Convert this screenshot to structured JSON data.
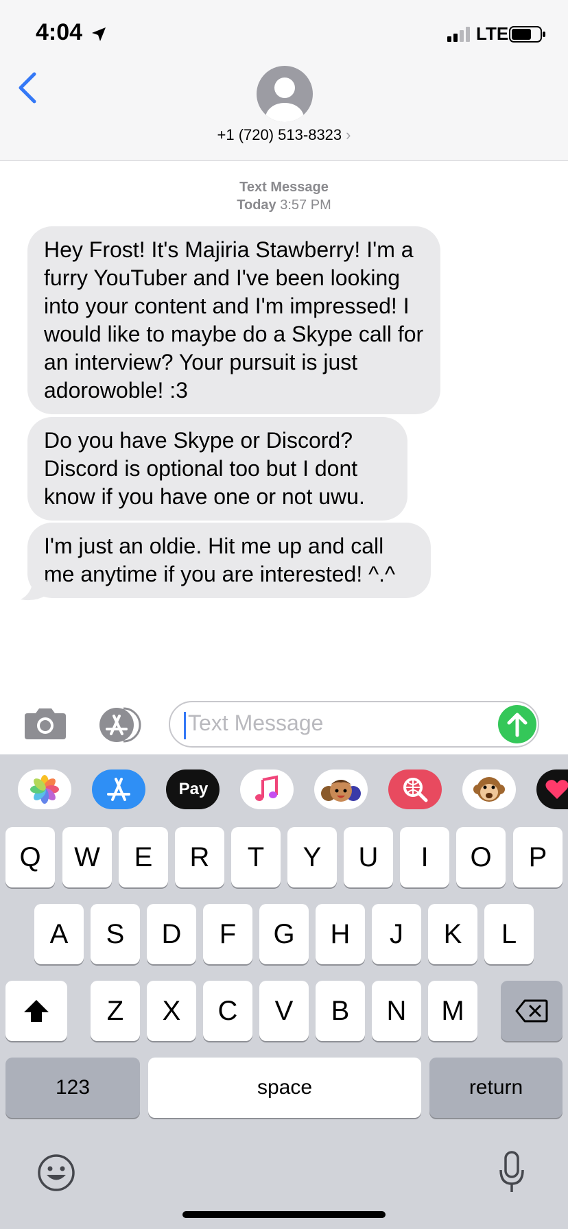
{
  "status_bar": {
    "time": "4:04",
    "network": "LTE"
  },
  "header": {
    "contact": "+1 (720) 513-8323",
    "chevron": "›"
  },
  "conversation": {
    "service_label": "Text Message",
    "day": "Today",
    "time": "3:57 PM",
    "messages": [
      {
        "text": "Hey Frost! It's Majiria Stawberry! I'm a furry YouTuber and I've been looking into your content and I'm impressed! I would like to maybe do a Skype call for an interview? Your pursuit is just adorowoble! :3"
      },
      {
        "text": "Do you have Skype or Discord? Discord is optional too but I dont know if you have one or not uwu."
      },
      {
        "text": "I'm just an oldie. Hit me up and call me anytime if you are interested! ^.^"
      }
    ]
  },
  "composer": {
    "placeholder": "Text Message"
  },
  "apps": {
    "apple_pay_label": "Pay",
    "apple_glyph": ""
  },
  "keyboard": {
    "row1": [
      "Q",
      "W",
      "E",
      "R",
      "T",
      "Y",
      "U",
      "I",
      "O",
      "P"
    ],
    "row2": [
      "A",
      "S",
      "D",
      "F",
      "G",
      "H",
      "J",
      "K",
      "L"
    ],
    "row3": [
      "Z",
      "X",
      "C",
      "V",
      "B",
      "N",
      "M"
    ],
    "numbers_label": "123",
    "space_label": "space",
    "return_label": "return"
  },
  "colors": {
    "accent": "#3478f6",
    "send": "#34c759",
    "bubble": "#e9e9eb"
  }
}
